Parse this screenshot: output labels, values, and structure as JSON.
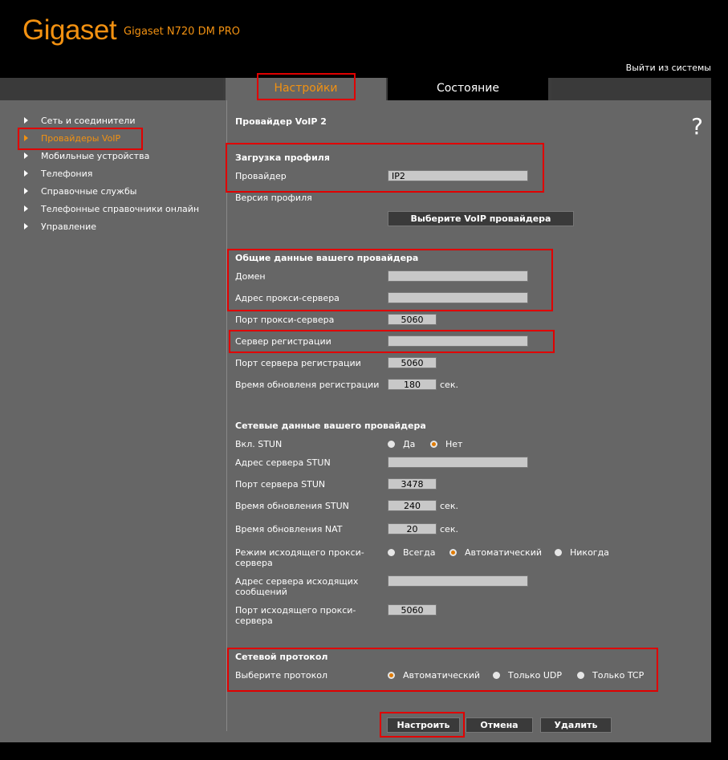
{
  "header": {
    "brand": "Gigaset",
    "model": "Gigaset N720 DM PRO",
    "logout": "Выйти из системы"
  },
  "tabs": {
    "settings": "Настройки",
    "status": "Состояние"
  },
  "nav": [
    {
      "label": "Сеть и соединители"
    },
    {
      "label": "Провайдеры VoIP"
    },
    {
      "label": "Мобильные устройства"
    },
    {
      "label": "Телефония"
    },
    {
      "label": "Справочные службы"
    },
    {
      "label": "Телефонные справочники онлайн"
    },
    {
      "label": "Управление"
    }
  ],
  "page": {
    "title": "Провайдер VoIP 2",
    "help": "?"
  },
  "profile": {
    "header": "Загрузка профиля",
    "provider_label": "Провайдер",
    "provider_value": "IP2",
    "version_label": "Версия профиля",
    "select_button": "Выберите VoIP провайдера"
  },
  "general": {
    "header": "Общие данные вашего провайдера",
    "domain_label": "Домен",
    "domain_value": "",
    "proxy_label": "Адрес прокси-сервера",
    "proxy_value": "",
    "proxy_port_label": "Порт прокси-сервера",
    "proxy_port_value": "5060",
    "registrar_label": "Сервер регистрации",
    "registrar_value": "",
    "registrar_port_label": "Порт сервера регистрации",
    "registrar_port_value": "5060",
    "reg_refresh_label": "Время обновленя регистрации",
    "reg_refresh_value": "180",
    "unit_sec": "сек."
  },
  "network": {
    "header": "Сетевые данные вашего провайдера",
    "stun_enable_label": "Вкл. STUN",
    "stun_yes": "Да",
    "stun_no": "Нет",
    "stun_server_label": "Адрес сервера STUN",
    "stun_server_value": "",
    "stun_port_label": "Порт сервера STUN",
    "stun_port_value": "3478",
    "stun_refresh_label": "Время обновления STUN",
    "stun_refresh_value": "240",
    "nat_refresh_label": "Время обновления NAT",
    "nat_refresh_value": "20",
    "outbound_mode_label_1": "Режим исходящего прокси-",
    "outbound_mode_label_2": "сервера",
    "mode_always": "Всегда",
    "mode_auto": "Автоматический",
    "mode_never": "Никогда",
    "outbound_server_label_1": "Адрес сервера исходящих",
    "outbound_server_label_2": "сообщений",
    "outbound_server_value": "",
    "outbound_port_label_1": "Порт исходящего прокси-",
    "outbound_port_label_2": "сервера",
    "outbound_port_value": "5060"
  },
  "protocol": {
    "header": "Сетевой протокол",
    "select_label": "Выберите протокол",
    "auto": "Автоматический",
    "udp": "Только UDP",
    "tcp": "Только TCP"
  },
  "actions": {
    "apply": "Настроить",
    "cancel": "Отмена",
    "delete": "Удалить"
  },
  "colors": {
    "accent": "#f29111",
    "highlight": "#e00000",
    "panel": "#666666"
  }
}
